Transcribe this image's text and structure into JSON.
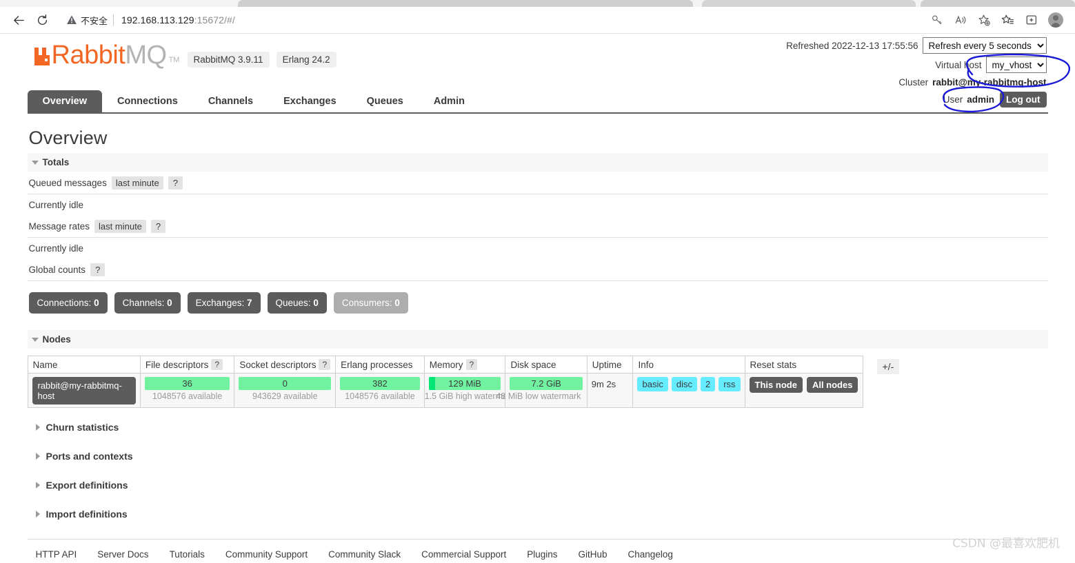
{
  "browser": {
    "back_icon": "back-arrow-icon",
    "reload_icon": "reload-icon",
    "security_warning_icon": "warning-triangle-icon",
    "security_label": "不安全",
    "url_main": "192.168.113.129",
    "url_port_path": ":15672/#/",
    "toolbar_icons": [
      "key-icon",
      "read-aloud-icon",
      "add-favorite-icon",
      "favorites-icon",
      "collections-icon",
      "profile-avatar-icon"
    ]
  },
  "app": {
    "logo_primary": "Rabbit",
    "logo_secondary": "MQ",
    "logo_tm": "TM",
    "version_badges": [
      "RabbitMQ 3.9.11",
      "Erlang 24.2"
    ]
  },
  "header": {
    "refreshed_label": "Refreshed 2022-12-13 17:55:56",
    "refresh_select_value": "Refresh every 5 seconds",
    "refresh_options": [
      "Refresh every 5 seconds"
    ],
    "vhost_label": "Virtual host",
    "vhost_value": "my_vhost",
    "vhost_options": [
      "my_vhost"
    ],
    "cluster_label": "Cluster",
    "cluster_value": "rabbit@my-rabbitmq-host",
    "user_label": "User",
    "user_value": "admin",
    "logout_label": "Log out"
  },
  "nav": {
    "tabs": [
      {
        "label": "Overview",
        "active": true
      },
      {
        "label": "Connections",
        "active": false
      },
      {
        "label": "Channels",
        "active": false
      },
      {
        "label": "Exchanges",
        "active": false
      },
      {
        "label": "Queues",
        "active": false
      },
      {
        "label": "Admin",
        "active": false
      }
    ]
  },
  "main": {
    "page_title": "Overview",
    "totals": {
      "section_label": "Totals",
      "queued_messages_label": "Queued messages",
      "queued_messages_chip": "last minute",
      "help_char": "?",
      "queued_idle": "Currently idle",
      "message_rates_label": "Message rates",
      "message_rates_chip": "last minute",
      "rates_idle": "Currently idle",
      "global_counts_label": "Global counts"
    },
    "counts": [
      {
        "label": "Connections:",
        "value": "0",
        "muted": false
      },
      {
        "label": "Channels:",
        "value": "0",
        "muted": false
      },
      {
        "label": "Exchanges:",
        "value": "7",
        "muted": false
      },
      {
        "label": "Queues:",
        "value": "0",
        "muted": false
      },
      {
        "label": "Consumers:",
        "value": "0",
        "muted": true
      }
    ],
    "nodes": {
      "section_label": "Nodes",
      "columns": [
        "Name",
        "File descriptors",
        "Socket descriptors",
        "Erlang processes",
        "Memory",
        "Disk space",
        "Uptime",
        "Info",
        "Reset stats"
      ],
      "expand_label": "+/-",
      "row": {
        "name": "rabbit@my-rabbitmq-host",
        "file_descriptors_value": "36",
        "file_descriptors_sub": "1048576 available",
        "socket_descriptors_value": "0",
        "socket_descriptors_sub": "943629 available",
        "erlang_processes_value": "382",
        "erlang_processes_sub": "1048576 available",
        "memory_value": "129 MiB",
        "memory_sub": "1.5 GiB high watermark",
        "disk_value": "7.2 GiB",
        "disk_sub": "48 MiB low watermark",
        "uptime": "9m 2s",
        "info_badges": [
          "basic",
          "disc",
          "2",
          "rss"
        ],
        "reset_buttons": [
          "This node",
          "All nodes"
        ]
      }
    },
    "collapsed_sections": [
      "Churn statistics",
      "Ports and contexts",
      "Export definitions",
      "Import definitions"
    ]
  },
  "footer": {
    "links": [
      "HTTP API",
      "Server Docs",
      "Tutorials",
      "Community Support",
      "Community Slack",
      "Commercial Support",
      "Plugins",
      "GitHub",
      "Changelog"
    ]
  },
  "watermark": "CSDN @最喜欢肥机",
  "colors": {
    "brand_orange": "#f16723",
    "dark_gray": "#5c5c5c",
    "bar_green": "#70f2a0",
    "bar_green_dark": "#00e676",
    "info_cyan": "#66ecff",
    "annotation_blue": "#1a1ad6"
  }
}
